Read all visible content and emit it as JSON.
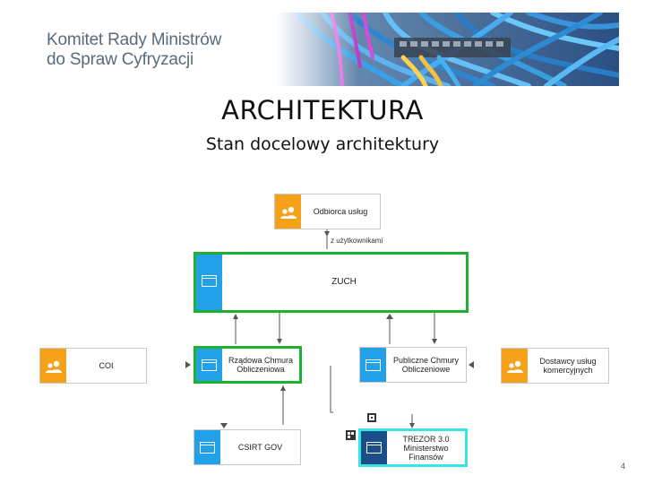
{
  "header": {
    "org_line1": "Komitet Rady Ministrów",
    "org_line2": "do Spraw Cyfryzacji"
  },
  "title": "ARCHITEKTURA",
  "subtitle": "Stan docelowy architektury",
  "diagram": {
    "nodes": {
      "odbiorca": {
        "label": "Odbiorca usług",
        "icon": "users-icon",
        "color": "#f5a21a"
      },
      "zuch": {
        "label": "ZUCH",
        "icon": "window-icon",
        "color": "#22a0e8",
        "border": "#1fb030"
      },
      "coi": {
        "label": "COI",
        "icon": "users-icon",
        "color": "#f5a21a"
      },
      "rzadowa": {
        "label": "Rządowa Chmura Obliczeniowa",
        "icon": "window-icon",
        "color": "#22a0e8",
        "border": "#1fb030"
      },
      "publiczne": {
        "label": "Publiczne Chmury Obliczeniowe",
        "icon": "window-icon",
        "color": "#22a0e8"
      },
      "dostawcy": {
        "label": "Dostawcy usług komercyjnych",
        "icon": "users-icon",
        "color": "#f5a21a"
      },
      "csirt": {
        "label": "CSIRT GOV",
        "icon": "window-icon",
        "color": "#22a0e8"
      },
      "trezor": {
        "label": "TREZOR 3.0 Ministerstwo Finansów",
        "icon": "window-icon",
        "color": "#1b4e86",
        "border": "#36e6e6"
      }
    },
    "edge_label": "z użytkownikami"
  },
  "page_number": "4"
}
